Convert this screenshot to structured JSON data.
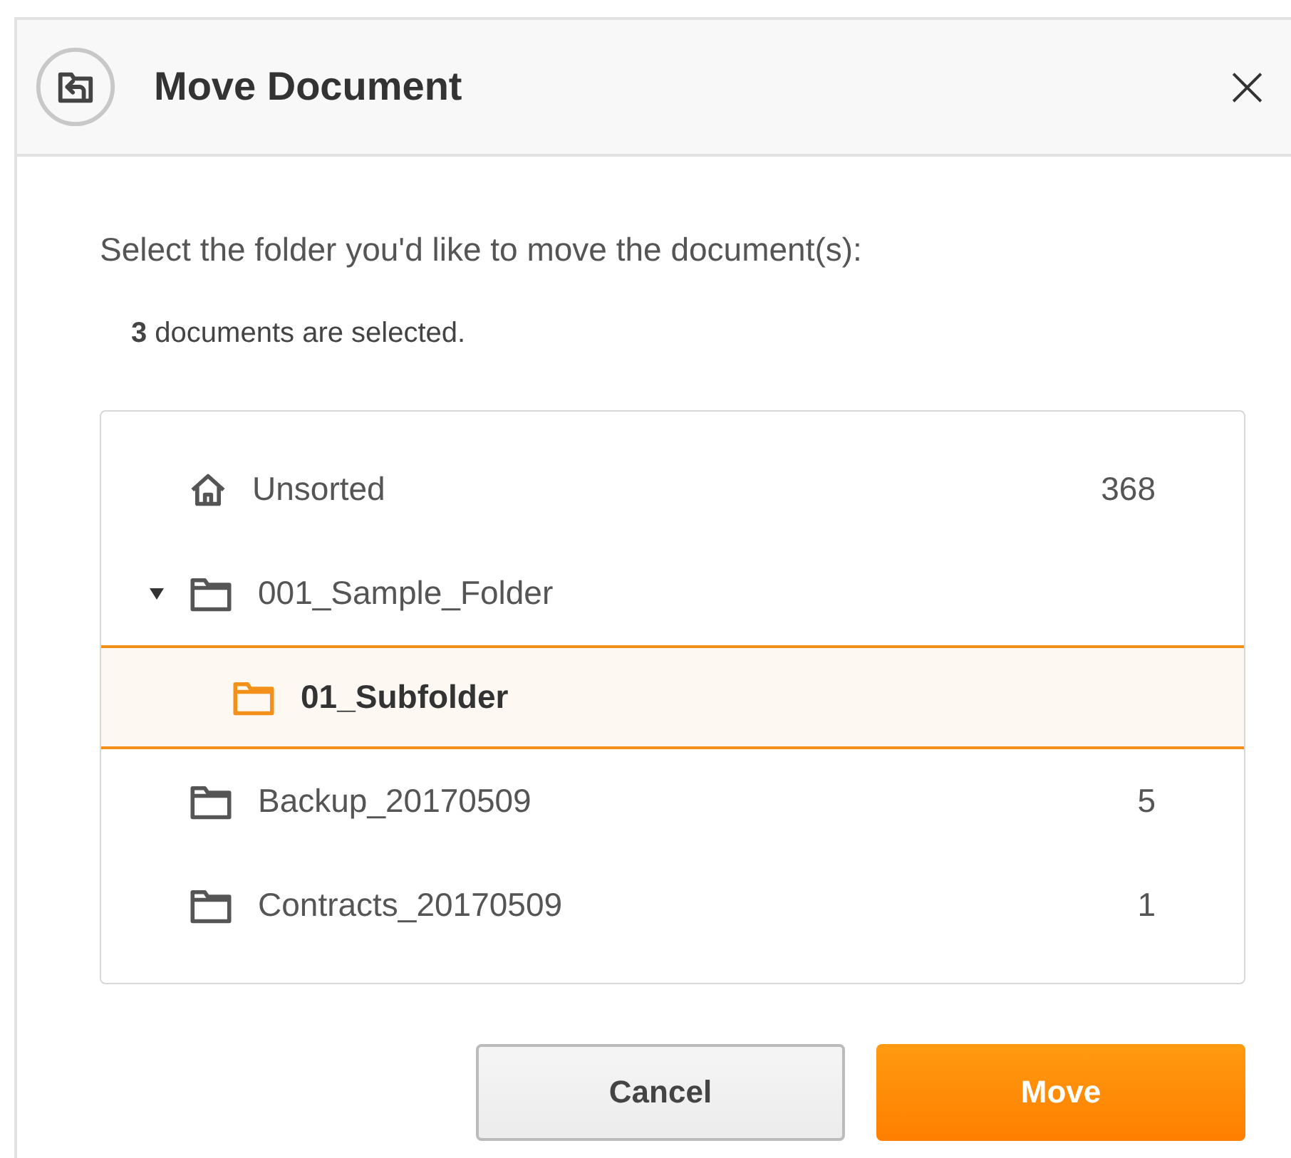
{
  "dialog": {
    "title": "Move Document",
    "close": "×"
  },
  "instruction": "Select the folder you'd like to move the document(s):",
  "selection_note": "**3** documents are selected.",
  "folders": [
    {
      "kind": "home",
      "name": "Unsorted",
      "count": "368",
      "selected": false
    },
    {
      "kind": "folder",
      "name": "001_Sample_Folder",
      "selected": false,
      "expanded": true,
      "children": [
        {
          "kind": "folder",
          "name": "01_Subfolder",
          "selected": true
        }
      ]
    },
    {
      "kind": "folder",
      "name": "Backup_20170509",
      "count": "5",
      "selected": false
    },
    {
      "kind": "folder",
      "name": "Contracts_20170509",
      "count": "1",
      "selected": false
    }
  ],
  "buttons": [
    {
      "kind": "secondary",
      "label": "Cancel"
    },
    {
      "kind": "primary",
      "label": "Move"
    }
  ]
}
